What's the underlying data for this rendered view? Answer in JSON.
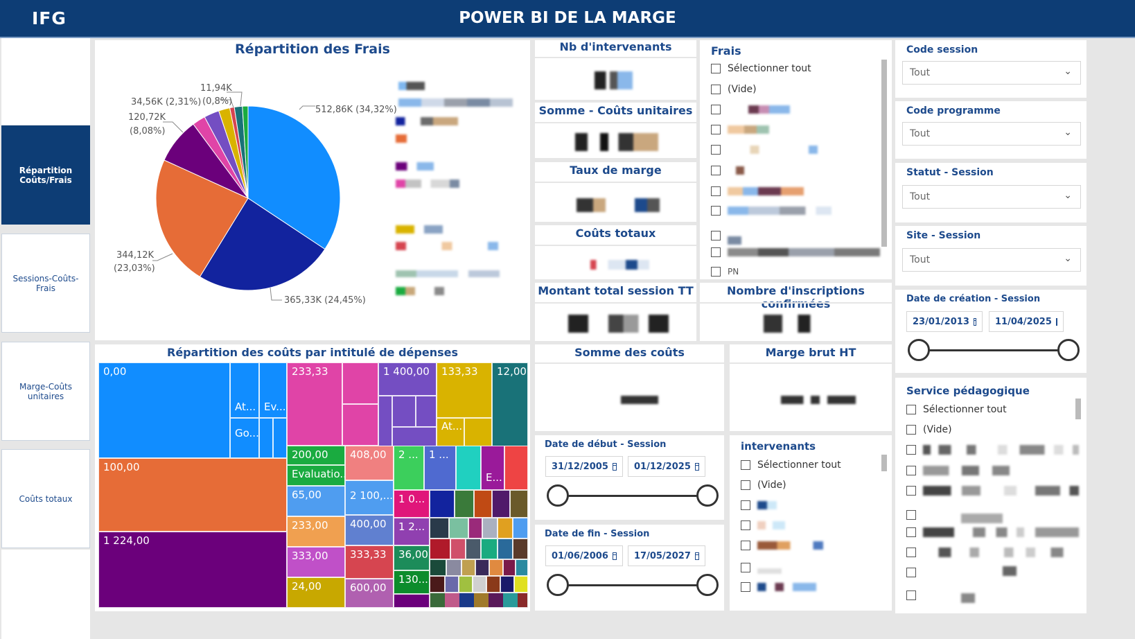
{
  "header": {
    "brand": "IFG",
    "title": "POWER BI DE LA MARGE"
  },
  "nav": {
    "items": [
      {
        "label": "Répartition Coûts/Frais",
        "active": true
      },
      {
        "label": "Sessions-Coûts-Frais",
        "active": false
      },
      {
        "label": "Marge-Coûts unitaires",
        "active": false
      },
      {
        "label": "Coûts totaux",
        "active": false
      }
    ]
  },
  "pie": {
    "title": "Répartition des Frais",
    "labels": {
      "l1": "11,94K",
      "l2": "34,56K (2,31%)",
      "l3": "(0,8%)",
      "l4": "120,72K",
      "l5": "(8,08%)",
      "l6": "512,86K (34,32%)",
      "l7": "344,12K",
      "l8": "(23,03%)",
      "l9": "365,33K (24,45%)"
    }
  },
  "chart_data": {
    "type": "pie",
    "title": "Répartition des Frais",
    "values": [
      512.86,
      365.33,
      344.12,
      120.72,
      34.56,
      11.94
    ],
    "percents": [
      34.32,
      24.45,
      23.03,
      8.08,
      2.31,
      0.8
    ],
    "colors": [
      "#118dff",
      "#12239e",
      "#e66c37",
      "#6b007b",
      "#e044a7",
      "#744ec2",
      "#d9b300",
      "#d64550",
      "#197278",
      "#1aab40"
    ]
  },
  "kpis": {
    "nb_intervenants": "Nb d'intervenants",
    "somme_couts_unitaires": "Somme - Coûts unitaires",
    "taux_marge": "Taux de marge",
    "couts_totaux": "Coûts totaux",
    "montant_total": "Montant total session TT",
    "nb_inscriptions": "Nombre d'inscriptions confirmées",
    "somme_couts": "Somme des coûts",
    "marge_brut": "Marge brut HT"
  },
  "frais_slicer": {
    "title": "Frais",
    "select_all": "Sélectionner tout",
    "empty": "(Vide)",
    "partial": "PN"
  },
  "dropdowns": [
    {
      "title": "Code session",
      "value": "Tout"
    },
    {
      "title": "Code programme",
      "value": "Tout"
    },
    {
      "title": "Statut - Session",
      "value": "Tout"
    },
    {
      "title": "Site - Session",
      "value": "Tout"
    }
  ],
  "date_creation": {
    "title": "Date de création - Session",
    "start": "23/01/2013",
    "end": "11/04/2025"
  },
  "date_debut": {
    "title": "Date de début - Session",
    "start": "31/12/2005",
    "end": "01/12/2025"
  },
  "date_fin": {
    "title": "Date de fin - Session",
    "start": "01/06/2006",
    "end": "17/05/2027"
  },
  "intervenants_slicer": {
    "title": "intervenants",
    "select_all": "Sélectionner tout",
    "empty": "(Vide)"
  },
  "service_slicer": {
    "title": "Service pédagogique",
    "select_all": "Sélectionner tout",
    "empty": "(Vide)"
  },
  "treemap": {
    "title": "Répartition des coûts par intitulé de dépenses",
    "cells": [
      "0,00",
      "At...",
      "Ev...",
      "Go...",
      "233,33",
      "1 400,00",
      "133,33",
      "12,00",
      "At...",
      "100,00",
      "1 224,00",
      "200,00",
      "Evaluatio...",
      "65,00",
      "233,00",
      "333,00",
      "24,00",
      "408,00",
      "2 100,...",
      "400,00",
      "333,33",
      "600,00",
      "2 ...",
      "1 ...",
      "1 0...",
      "1 2...",
      "36,00",
      "130...",
      "E..."
    ]
  }
}
